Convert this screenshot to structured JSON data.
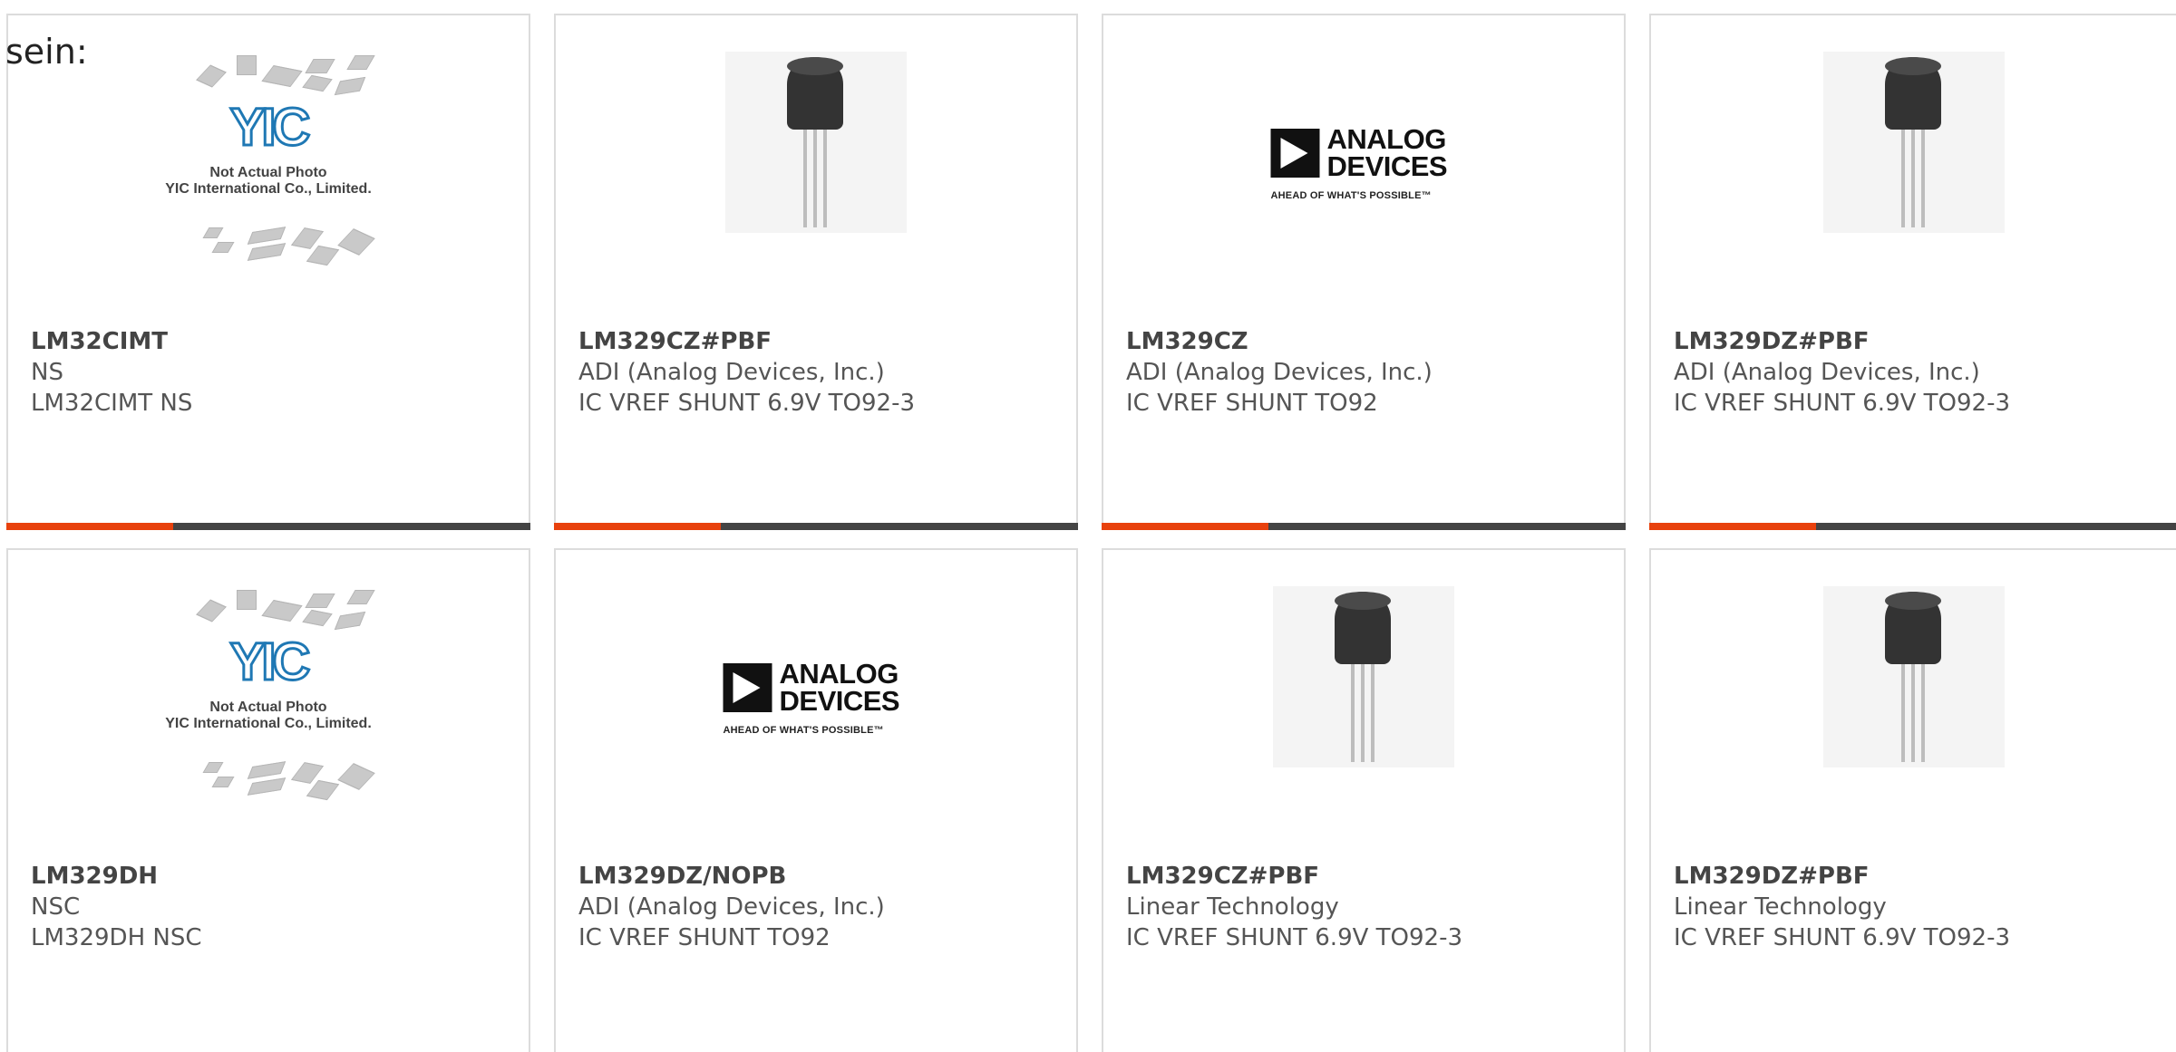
{
  "page": {
    "heading": "sein:"
  },
  "products": [
    {
      "part": "LM32CIMT",
      "manufacturer": "NS",
      "description": "LM32CIMT NS",
      "image_type": "placeholder-icon",
      "placeholder_logo": "YIC",
      "placeholder_caption1": "Not Actual Photo",
      "placeholder_caption2": "YIC International Co., Limited."
    },
    {
      "part": "LM329CZ#PBF",
      "manufacturer": "ADI (Analog Devices, Inc.)",
      "description": "IC VREF SHUNT 6.9V TO92-3",
      "image_type": "transistor-photo"
    },
    {
      "part": "LM329CZ",
      "manufacturer": "ADI (Analog Devices, Inc.)",
      "description": "IC VREF SHUNT TO92",
      "image_type": "analog-devices-logo",
      "logo_line1": "ANALOG",
      "logo_line2": "DEVICES",
      "logo_tagline": "AHEAD OF WHAT'S POSSIBLE™"
    },
    {
      "part": "LM329DZ#PBF",
      "manufacturer": "ADI (Analog Devices, Inc.)",
      "description": "IC VREF SHUNT 6.9V TO92-3",
      "image_type": "transistor-photo"
    },
    {
      "part": "LM329DH",
      "manufacturer": "NSC",
      "description": "LM329DH NSC",
      "image_type": "placeholder-icon",
      "placeholder_logo": "YIC",
      "placeholder_caption1": "Not Actual Photo",
      "placeholder_caption2": "YIC International Co., Limited."
    },
    {
      "part": "LM329DZ/NOPB",
      "manufacturer": "ADI (Analog Devices, Inc.)",
      "description": "IC VREF SHUNT TO92",
      "image_type": "analog-devices-logo",
      "logo_line1": "ANALOG",
      "logo_line2": "DEVICES",
      "logo_tagline": "AHEAD OF WHAT'S POSSIBLE™"
    },
    {
      "part": "LM329CZ#PBF",
      "manufacturer": "Linear Technology",
      "description": "IC VREF SHUNT 6.9V TO92-3",
      "image_type": "transistor-photo"
    },
    {
      "part": "LM329DZ#PBF",
      "manufacturer": "Linear Technology",
      "description": "IC VREF SHUNT 6.9V TO92-3",
      "image_type": "transistor-photo"
    }
  ],
  "colors": {
    "accent": "#e8410d",
    "bar": "#444444",
    "border": "#dcdcdc",
    "text": "#555555",
    "yic_blue": "#1f78b4"
  }
}
